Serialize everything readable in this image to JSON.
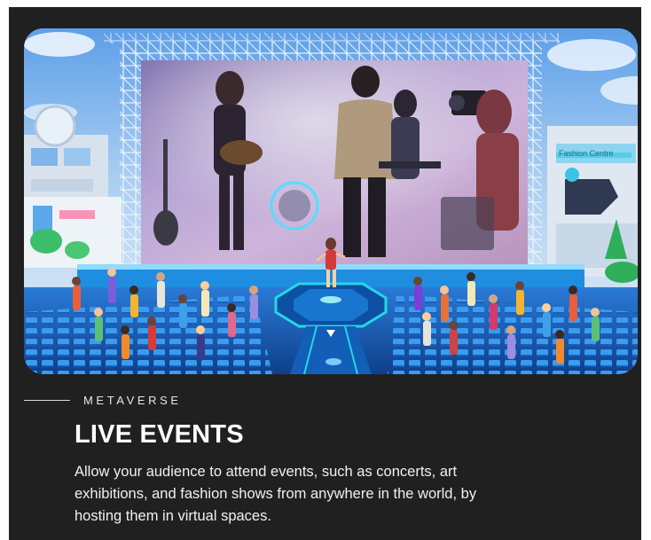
{
  "section": {
    "eyebrow": "METAVERSE",
    "title": "LIVE EVENTS",
    "description": "Allow your audience to attend events, such as concerts, art exhibitions, and fashion shows from anywhere in the world, by hosting them in virtual spaces."
  },
  "hero_image": {
    "icon": "virtual-concert-scene-image",
    "sign_text": "Fashion Centre"
  },
  "colors": {
    "panel_background": "#202020",
    "page_background": "#ffffff",
    "text_primary": "#ffffff",
    "stage_accent": "#22d8e6"
  }
}
